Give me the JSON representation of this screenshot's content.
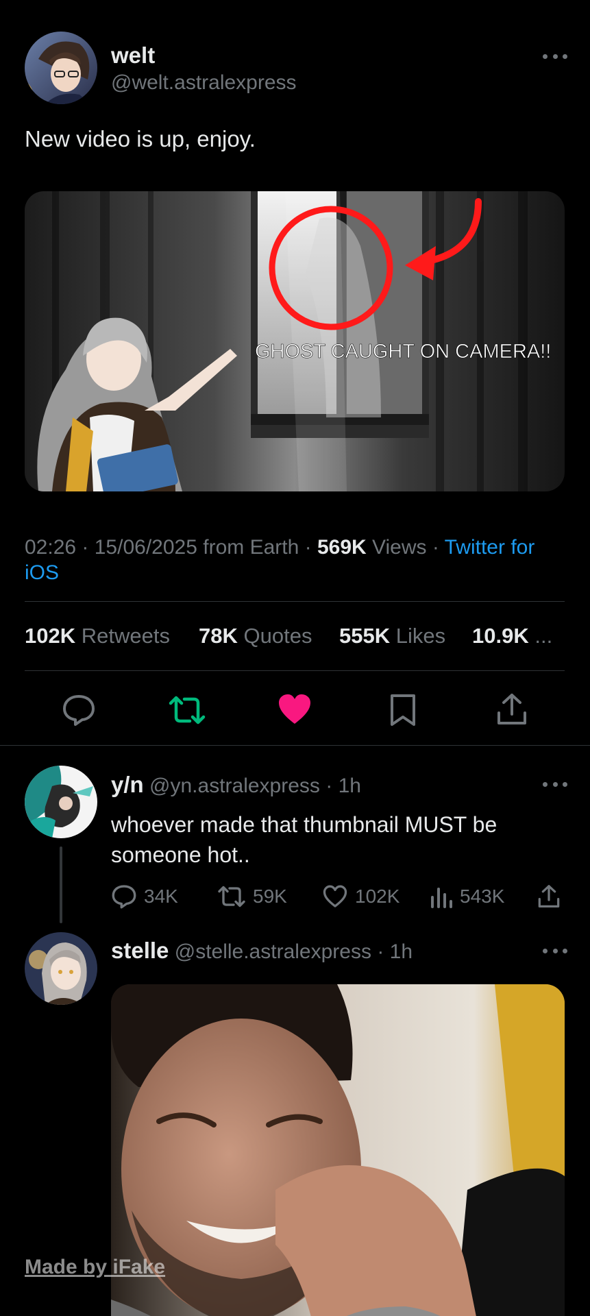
{
  "main_tweet": {
    "author_name": "welt",
    "author_handle": "@welt.astralexpress",
    "text": "New video is up, enjoy.",
    "media_caption": "GHOST CAUGHT ON CAMERA!!",
    "time": "02:26",
    "date": "15/06/2025",
    "source_prefix": "from Earth",
    "views_count": "569K",
    "views_label": "Views",
    "client_part1": "Twitter for",
    "client_part2": "iOS",
    "stats": {
      "retweets_count": "102K",
      "retweets_label": "Retweets",
      "quotes_count": "78K",
      "quotes_label": "Quotes",
      "likes_count": "555K",
      "likes_label": "Likes",
      "bookmarks_count": "10.9K",
      "bookmarks_label": "..."
    }
  },
  "reply1": {
    "author_name": "y/n",
    "author_handle": "@yn.astralexpress",
    "time": "· 1h",
    "text_line1": "whoever made that thumbnail MUST be",
    "text_line2": "someone hot..",
    "replies": "34K",
    "retweets": "59K",
    "likes": "102K",
    "views": "543K"
  },
  "reply2": {
    "author_name": "stelle",
    "author_handle": "@stelle.astralexpress",
    "time": "· 1h"
  },
  "watermark": "Made by iFake",
  "colors": {
    "background": "#000000",
    "text": "#e7e9ea",
    "muted": "#71767b",
    "link": "#1d9bf0",
    "retweet_green": "#00ba7c",
    "like_pink": "#f91880",
    "divider": "#2f3336"
  },
  "icons": [
    "more-icon",
    "reply-icon",
    "retweet-icon",
    "like-icon",
    "bookmark-icon",
    "share-icon",
    "views-icon"
  ]
}
